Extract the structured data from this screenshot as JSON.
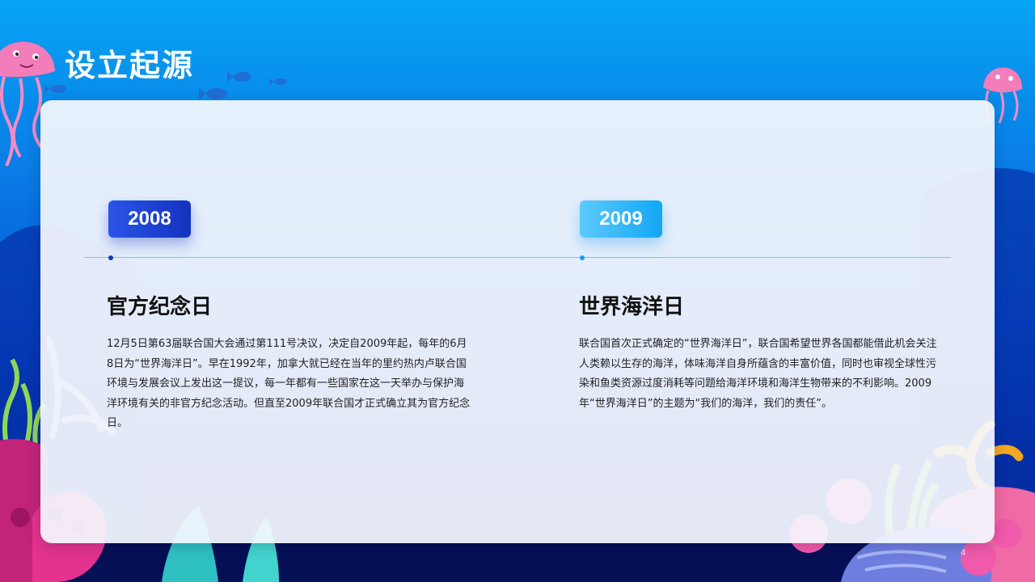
{
  "slide": {
    "title": "设立起源",
    "page_number": "4"
  },
  "left_column": {
    "year": "2008",
    "heading": "官方纪念日",
    "body": "12月5日第63届联合国大会通过第111号决议，决定自2009年起，每年的6月8日为“世界海洋日”。早在1992年，加拿大就已经在当年的里约热内卢联合国环境与发展会议上发出这一提议，每一年都有一些国家在这一天举办与保护海洋环境有关的非官方纪念活动。但直至2009年联合国才正式确立其为官方纪念日。"
  },
  "right_column": {
    "year": "2009",
    "heading": "世界海洋日",
    "body": "联合国首次正式确定的“世界海洋日”，联合国希望世界各国都能借此机会关注人类赖以生存的海洋，体味海洋自身所蕴含的丰富价值，同时也审视全球性污染和鱼类资源过度消耗等问题给海洋环境和海洋生物带来的不利影响。2009年“世界海洋日”的主题为“我们的海洋，我们的责任”。"
  },
  "colors": {
    "background_top": "#06a4f4",
    "background_bottom": "#041f7a",
    "year_2008_badge": "#1432bd",
    "year_2009_badge": "#13a6f5"
  },
  "decorations": [
    "jellyfish-icon",
    "fish-icon",
    "coral-icon",
    "seaweed-icon",
    "anemone-icon"
  ]
}
